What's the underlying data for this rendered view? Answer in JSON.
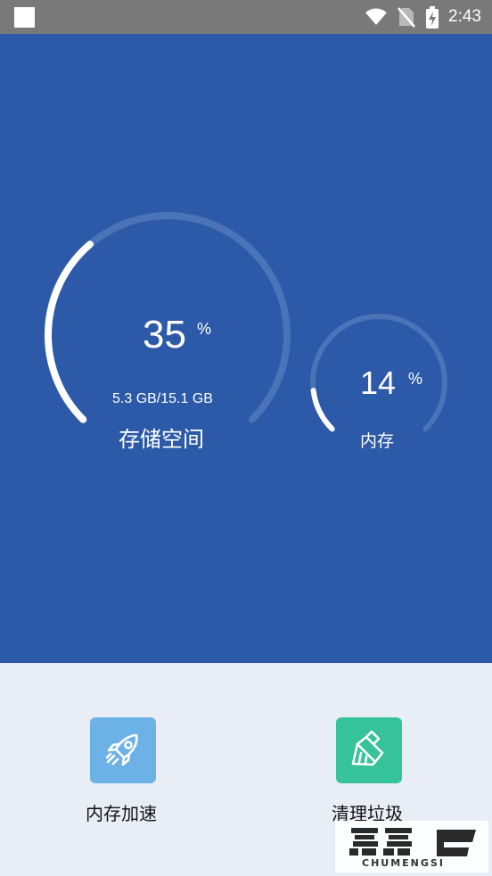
{
  "status_bar": {
    "time": "2:43",
    "icons": [
      "square-notification-icon",
      "wifi-icon",
      "no-sim-icon",
      "battery-charging-icon"
    ]
  },
  "colors": {
    "status_bar": "#797979",
    "hero_background": "#2c5aa8",
    "track": "#4a73b8",
    "progress": "#ffffff",
    "panel_background": "#e9edf5",
    "boost_icon_bg": "#6db2e7",
    "clean_icon_bg": "#37c39a"
  },
  "storage_gauge": {
    "percent_value": "35",
    "percent_symbol": "%",
    "usage": "5.3 GB/15.1 GB",
    "label": "存储空间",
    "fill": 0.35
  },
  "memory_gauge": {
    "percent_value": "14",
    "percent_symbol": "%",
    "label": "内存",
    "fill": 0.14
  },
  "actions": [
    {
      "label": "内存加速",
      "icon": "rocket-icon"
    },
    {
      "label": "清理垃圾",
      "icon": "broom-icon"
    }
  ],
  "watermark": {
    "caption": "CHUMENGSI"
  }
}
